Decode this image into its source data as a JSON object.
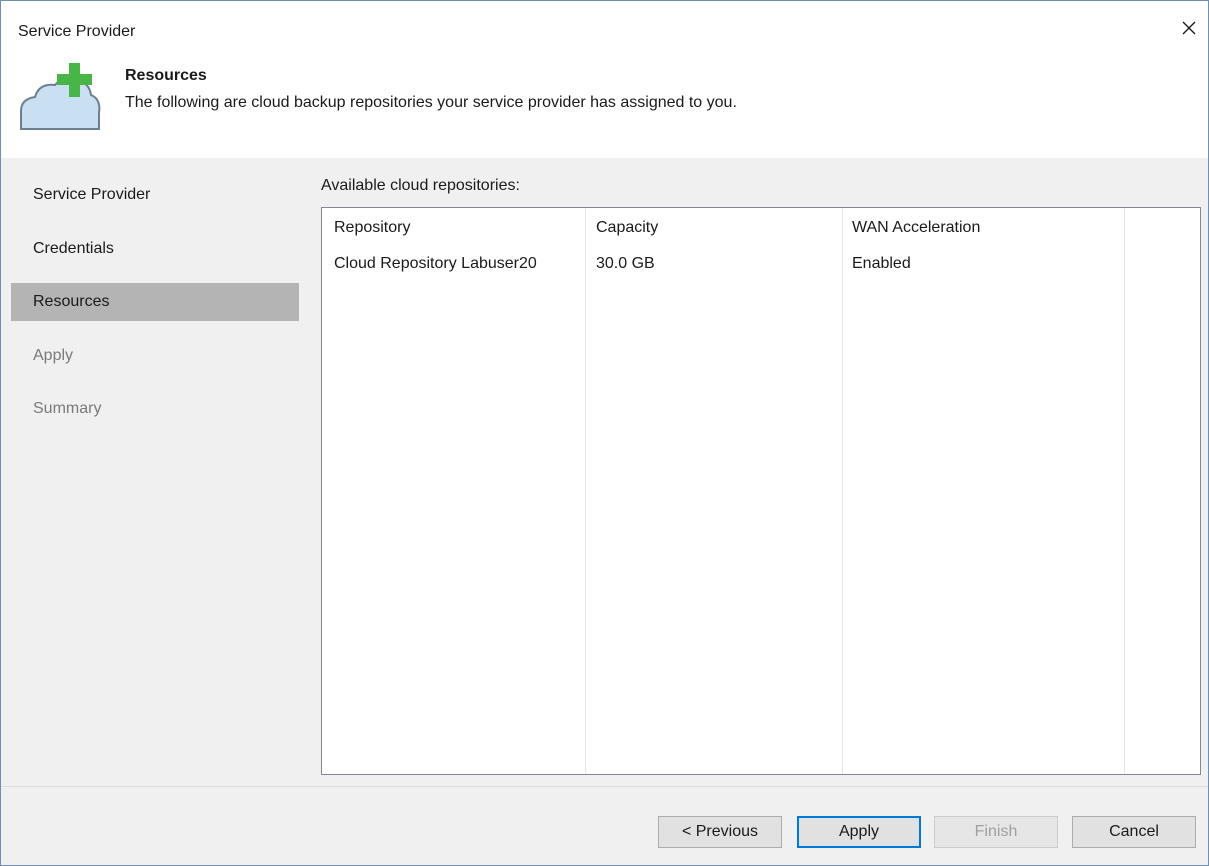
{
  "window": {
    "title": "Service Provider"
  },
  "header": {
    "title": "Resources",
    "description": "The following are cloud backup repositories your service provider has assigned to you.",
    "icon": "cloud-plus-icon"
  },
  "sidebar": {
    "items": [
      {
        "label": "Service Provider",
        "state": "normal"
      },
      {
        "label": "Credentials",
        "state": "normal"
      },
      {
        "label": "Resources",
        "state": "active"
      },
      {
        "label": "Apply",
        "state": "disabled"
      },
      {
        "label": "Summary",
        "state": "disabled"
      }
    ]
  },
  "main": {
    "label": "Available cloud repositories:",
    "table": {
      "columns": [
        "Repository",
        "Capacity",
        "WAN Acceleration"
      ],
      "rows": [
        [
          "Cloud Repository Labuser20",
          "30.0 GB",
          "Enabled"
        ]
      ]
    }
  },
  "footer": {
    "previous_label": "< Previous",
    "apply_label": "Apply",
    "finish_label": "Finish",
    "cancel_label": "Cancel"
  },
  "colors": {
    "accent": "#0078d7",
    "active_nav": "#b4b4b4",
    "cloud_fill": "#c9dff2",
    "plus_green": "#48b548"
  }
}
